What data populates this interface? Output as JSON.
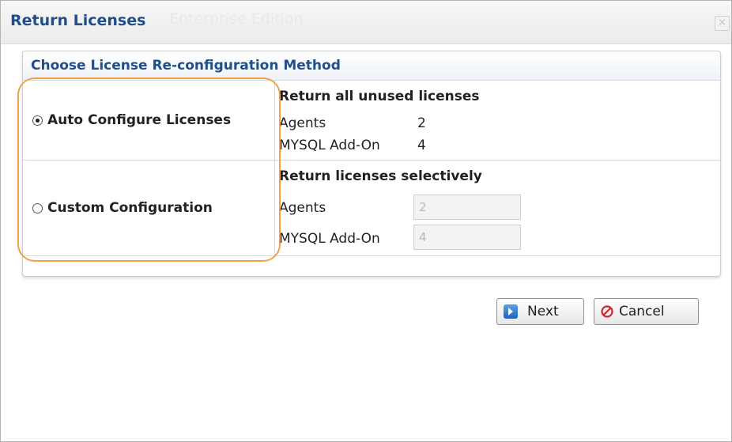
{
  "dialog": {
    "title": "Return Licenses",
    "subtitle": "Enterprise Edition",
    "close_glyph": "×"
  },
  "panel": {
    "title": "Choose License Re-configuration Method",
    "auto": {
      "label": "Auto Configure Licenses",
      "selected": true,
      "heading": "Return all unused licenses",
      "agents_label": "Agents",
      "agents_value": "2",
      "mysql_label": "MYSQL Add-On",
      "mysql_value": "4"
    },
    "custom": {
      "label": "Custom Configuration",
      "selected": false,
      "heading": "Return licenses selectively",
      "agents_label": "Agents",
      "agents_value": "2",
      "mysql_label": "MYSQL Add-On",
      "mysql_value": "4"
    }
  },
  "buttons": {
    "next_label": "Next",
    "cancel_label": "Cancel"
  },
  "icons": {
    "next": "arrow-right-icon",
    "cancel": "no-entry-icon",
    "close": "close-icon"
  },
  "colors": {
    "title": "#1f4f8a",
    "highlight": "#f0a24a",
    "cancel_icon": "#d0262b",
    "next_icon": "#2b6fc2"
  }
}
